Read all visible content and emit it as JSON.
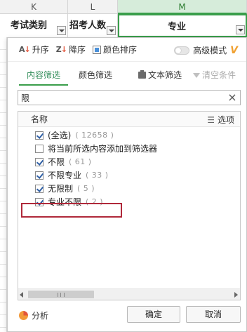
{
  "sheet": {
    "columns": [
      "K",
      "L",
      "M"
    ],
    "headers": [
      "考试类别",
      "招考人数",
      "专业"
    ]
  },
  "sort_bar": {
    "asc_label": "升序",
    "desc_label": "降序",
    "color_sort_label": "颜色排序",
    "advanced_label": "高级模式",
    "advanced_enabled": false
  },
  "tabs": {
    "content_filter": "内容筛选",
    "color_filter": "颜色筛选",
    "active": "内容筛选",
    "text_filter": "文本筛选",
    "clear_conditions": "清空条件"
  },
  "search": {
    "value": "限"
  },
  "list": {
    "header_title": "名称",
    "options_label": "选项",
    "items": [
      {
        "label": "(全选)",
        "count": "( 12658 )",
        "checked": true
      },
      {
        "label": "将当前所选内容添加到筛选器",
        "count": "",
        "checked": false
      },
      {
        "label": "不限",
        "count": "( 61 )",
        "checked": true
      },
      {
        "label": "不限专业",
        "count": "( 33 )",
        "checked": true
      },
      {
        "label": "无限制",
        "count": "( 5 )",
        "checked": true
      },
      {
        "label": "专业不限",
        "count": "( 2 )",
        "checked": true
      }
    ]
  },
  "footer": {
    "analysis_label": "分析",
    "ok_label": "确定",
    "cancel_label": "取消"
  },
  "colors": {
    "accent_green": "#3a9e4b",
    "highlight_red": "#b0283a"
  }
}
